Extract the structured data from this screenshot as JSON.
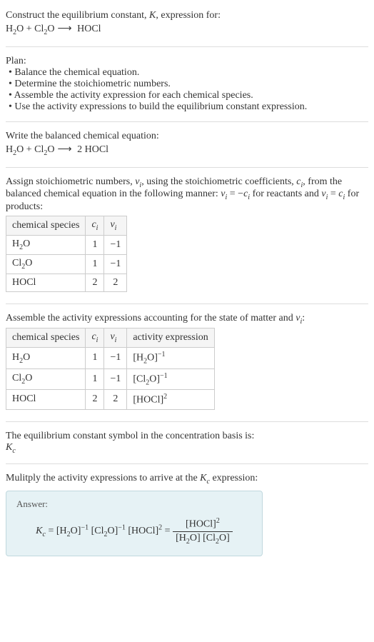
{
  "header": {
    "title_prefix": "Construct the equilibrium constant, ",
    "title_K": "K",
    "title_suffix": ", expression for:",
    "equation_lhs_h2o": "H",
    "equation_lhs_h2o_sub": "2",
    "equation_lhs_h2o_o": "O",
    "equation_plus": " + ",
    "equation_lhs_cl2o_cl": "Cl",
    "equation_lhs_cl2o_sub": "2",
    "equation_lhs_cl2o_o": "O",
    "equation_arrow": "⟶",
    "equation_rhs": " HOCl"
  },
  "plan": {
    "heading": "Plan:",
    "item1": "• Balance the chemical equation.",
    "item2": "• Determine the stoichiometric numbers.",
    "item3": "• Assemble the activity expression for each chemical species.",
    "item4": "• Use the activity expressions to build the equilibrium constant expression."
  },
  "balanced": {
    "heading": "Write the balanced chemical equation:",
    "lhs_h2o_h": "H",
    "lhs_h2o_sub": "2",
    "lhs_h2o_o": "O",
    "plus": " + ",
    "lhs_cl2o_cl": "Cl",
    "lhs_cl2o_sub": "2",
    "lhs_cl2o_o": "O",
    "arrow": "⟶",
    "rhs": " 2 HOCl"
  },
  "stoich": {
    "heading_prefix": "Assign stoichiometric numbers, ",
    "nu_i": "ν",
    "nu_sub": "i",
    "heading_mid": ", using the stoichiometric coefficients, ",
    "c_i": "c",
    "c_sub": "i",
    "heading_mid2": ", from the balanced chemical equation in the following manner: ",
    "eq1_lhs": "ν",
    "eq1_lhs_sub": "i",
    "eq1_eq": " = −",
    "eq1_rhs": "c",
    "eq1_rhs_sub": "i",
    "heading_mid3": " for reactants and ",
    "eq2_lhs": "ν",
    "eq2_lhs_sub": "i",
    "eq2_eq": " = ",
    "eq2_rhs": "c",
    "eq2_rhs_sub": "i",
    "heading_end": " for products:",
    "table": {
      "h1": "chemical species",
      "h2_c": "c",
      "h2_sub": "i",
      "h3_nu": "ν",
      "h3_sub": "i",
      "r1_sp_h": "H",
      "r1_sp_sub": "2",
      "r1_sp_o": "O",
      "r1_c": "1",
      "r1_nu": "−1",
      "r2_sp_cl": "Cl",
      "r2_sp_sub": "2",
      "r2_sp_o": "O",
      "r2_c": "1",
      "r2_nu": "−1",
      "r3_sp": "HOCl",
      "r3_c": "2",
      "r3_nu": "2"
    }
  },
  "activity": {
    "heading_prefix": "Assemble the activity expressions accounting for the state of matter and ",
    "nu": "ν",
    "nu_sub": "i",
    "heading_suffix": ":",
    "table": {
      "h1": "chemical species",
      "h2_c": "c",
      "h2_sub": "i",
      "h3_nu": "ν",
      "h3_sub": "i",
      "h4": "activity expression",
      "r1_sp_h": "H",
      "r1_sp_sub": "2",
      "r1_sp_o": "O",
      "r1_c": "1",
      "r1_nu": "−1",
      "r1_act_lb": "[H",
      "r1_act_sub": "2",
      "r1_act_rb": "O]",
      "r1_act_sup": "−1",
      "r2_sp_cl": "Cl",
      "r2_sp_sub": "2",
      "r2_sp_o": "O",
      "r2_c": "1",
      "r2_nu": "−1",
      "r2_act_lb": "[Cl",
      "r2_act_sub": "2",
      "r2_act_rb": "O]",
      "r2_act_sup": "−1",
      "r3_sp": "HOCl",
      "r3_c": "2",
      "r3_nu": "2",
      "r3_act_lb": "[HOCl]",
      "r3_act_sup": "2"
    }
  },
  "symbol": {
    "heading": "The equilibrium constant symbol in the concentration basis is:",
    "K": "K",
    "sub": "c"
  },
  "multiply": {
    "heading_prefix": "Mulitply the activity expressions to arrive at the ",
    "K": "K",
    "sub": "c",
    "heading_suffix": " expression:"
  },
  "answer": {
    "label": "Answer:",
    "K": "K",
    "K_sub": "c",
    "eq": " = ",
    "t1_lb": "[H",
    "t1_sub": "2",
    "t1_rb": "O]",
    "t1_sup": "−1",
    "sp1": " ",
    "t2_lb": "[Cl",
    "t2_sub": "2",
    "t2_rb": "O]",
    "t2_sup": "−1",
    "sp2": " ",
    "t3_lb": "[HOCl]",
    "t3_sup": "2",
    "eq2": " = ",
    "num_lb": "[HOCl]",
    "num_sup": "2",
    "den_t1_lb": "[H",
    "den_t1_sub": "2",
    "den_t1_rb": "O]",
    "den_sp": " ",
    "den_t2_lb": "[Cl",
    "den_t2_sub": "2",
    "den_t2_rb": "O]"
  }
}
